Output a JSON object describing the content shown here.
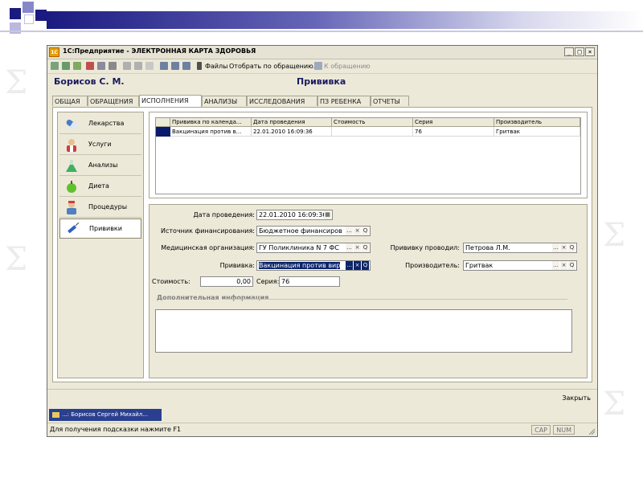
{
  "window": {
    "title": "1С:Предприятие - ЭЛЕКТРОННАЯ КАРТА ЗДОРОВЬЯ",
    "app_icon_text": "1C",
    "minimize_glyph": "_",
    "maximize_glyph": "□",
    "close_glyph": "×"
  },
  "toolbar": {
    "files_label": "Файлы",
    "show_by_request_label": "Отобрать по обращению...",
    "to_request_label": "К обращению"
  },
  "header": {
    "patient_name": "Борисов С. М.",
    "document_title": "Прививка"
  },
  "tabs": [
    "ОБЩАЯ",
    "ОБРАЩЕНИЯ",
    "ИСПОЛНЕНИЯ",
    "АНАЛИЗЫ",
    "ИССЛЕДОВАНИЯ",
    "ПЗ РЕБЕНКА",
    "ОТЧЕТЫ"
  ],
  "active_tab": "ИСПОЛНЕНИЯ",
  "sidebar": {
    "items": [
      {
        "label": "Лекарства",
        "icon": "capsule-icon"
      },
      {
        "label": "Услуги",
        "icon": "doctor-icon"
      },
      {
        "label": "Анализы",
        "icon": "flask-icon"
      },
      {
        "label": "Диета",
        "icon": "apple-icon"
      },
      {
        "label": "Процедуры",
        "icon": "nurse-icon"
      },
      {
        "label": "Прививки",
        "icon": "syringe-icon"
      }
    ],
    "active": "Прививки"
  },
  "grid": {
    "columns": [
      "Прививка по календа...",
      "Дата проведения",
      "Стоимость",
      "Серия",
      "Производитель"
    ],
    "rows": [
      [
        "Вакцинация против в...",
        "22.01.2010 16:09:36",
        "",
        "76",
        "Гритвак"
      ]
    ]
  },
  "form": {
    "date_label": "Дата проведения:",
    "date_value": "22.01.2010 16:09:36",
    "finance_label": "Источник финансирования:",
    "finance_value": "Бюджетное финансиров",
    "org_label": "Медицинская организация:",
    "org_value": "ГУ Поликлиника N 7 ФС",
    "performer_label": "Прививку проводил:",
    "performer_value": "Петрова Л.М.",
    "vaccination_label": "Прививка:",
    "vaccination_value": "Вакцинация против вир",
    "manufacturer_label": "Производитель:",
    "manufacturer_value": "Гритвак",
    "cost_label": "Стоимость:",
    "cost_value": "0,00",
    "series_label": "Серия:",
    "series_value": "76",
    "extra_info_label": "Дополнительная информация",
    "btn_ellipsis": "...",
    "btn_clear": "×",
    "btn_search": "Q"
  },
  "footer": {
    "close_label": "Закрыть"
  },
  "taskbar": {
    "window_tab": "...: Борисов Сергей Михайл..."
  },
  "status": {
    "hint": "Для получения подсказки нажмите F1",
    "cap": "CAP",
    "num": "NUM"
  },
  "colors": {
    "accent": "#0a246a",
    "header_text": "#1a1a60",
    "window_bg": "#ece9d8"
  }
}
